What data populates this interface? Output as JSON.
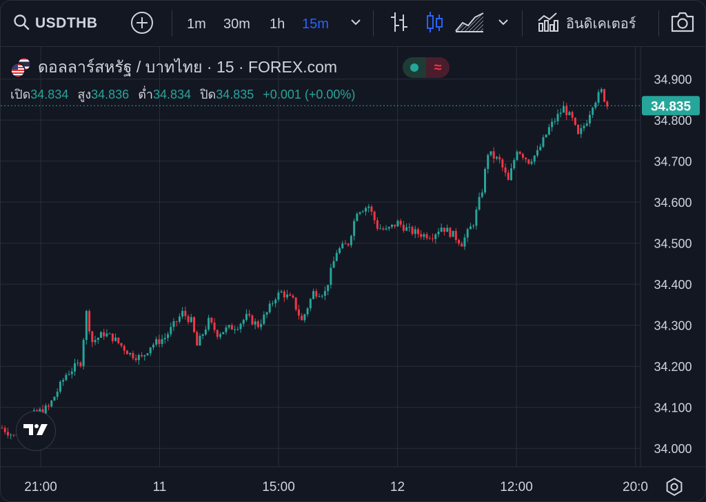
{
  "toolbar": {
    "symbol": "USDTHB",
    "timeframes": [
      {
        "label": "1m",
        "active": false
      },
      {
        "label": "30m",
        "active": false
      },
      {
        "label": "1h",
        "active": false
      },
      {
        "label": "15m",
        "active": true
      }
    ],
    "indicators_label": "อินดิเคเตอร์",
    "icons": [
      "search-icon",
      "plus-circle-icon",
      "chevron-down-icon",
      "bar-chart-icon",
      "candlestick-icon",
      "area-chart-icon",
      "indicators-icon",
      "camera-icon"
    ]
  },
  "legend": {
    "title": "ดอลลาร์สหรัฐ / บาทไทย · 15 · FOREX.com",
    "open_label": "เปิด",
    "open": "34.834",
    "high_label": "สูง",
    "high": "34.836",
    "low_label": "ต่ำ",
    "low": "34.834",
    "close_label": "ปิด",
    "close": "34.835",
    "change": "+0.001 (+0.00%)"
  },
  "colors": {
    "background": "#131722",
    "up": "#26a69a",
    "down": "#f23645",
    "grid": "#2a2e39",
    "accent": "#2962ff"
  },
  "chart_data": {
    "type": "candlestick",
    "symbol": "USDTHB",
    "interval": "15",
    "ylim": [
      33.955,
      34.98
    ],
    "y_ticks": [
      "34.900",
      "34.800",
      "34.700",
      "34.600",
      "34.500",
      "34.400",
      "34.300",
      "34.200",
      "34.100",
      "34.000"
    ],
    "x_ticks": [
      "21:00",
      "11",
      "15:00",
      "12",
      "12:00",
      "20:0"
    ],
    "last_price": "34.835",
    "close_path": [
      [
        0,
        34.05
      ],
      [
        4,
        34.03
      ],
      [
        10,
        34.08
      ],
      [
        16,
        34.1
      ],
      [
        22,
        34.18
      ],
      [
        27,
        34.21
      ],
      [
        29,
        34.33
      ],
      [
        31,
        34.26
      ],
      [
        35,
        34.28
      ],
      [
        38,
        34.27
      ],
      [
        44,
        34.23
      ],
      [
        48,
        34.22
      ],
      [
        51,
        34.25
      ],
      [
        56,
        34.27
      ],
      [
        59,
        34.3
      ],
      [
        62,
        34.33
      ],
      [
        65,
        34.31
      ],
      [
        67,
        34.25
      ],
      [
        71,
        34.31
      ],
      [
        74,
        34.28
      ],
      [
        77,
        34.29
      ],
      [
        81,
        34.3
      ],
      [
        84,
        34.32
      ],
      [
        88,
        34.3
      ],
      [
        91,
        34.33
      ],
      [
        94,
        34.37
      ],
      [
        96,
        34.38
      ],
      [
        100,
        34.36
      ],
      [
        103,
        34.31
      ],
      [
        107,
        34.38
      ],
      [
        111,
        34.38
      ],
      [
        115,
        34.48
      ],
      [
        119,
        34.5
      ],
      [
        122,
        34.58
      ],
      [
        126,
        34.59
      ],
      [
        129,
        34.54
      ],
      [
        132,
        34.53
      ],
      [
        136,
        34.55
      ],
      [
        140,
        34.53
      ],
      [
        145,
        34.52
      ],
      [
        148,
        34.52
      ],
      [
        151,
        34.54
      ],
      [
        155,
        34.52
      ],
      [
        158,
        34.5
      ],
      [
        162,
        34.55
      ],
      [
        165,
        34.63
      ],
      [
        167,
        34.72
      ],
      [
        171,
        34.7
      ],
      [
        174,
        34.65
      ],
      [
        177,
        34.73
      ],
      [
        181,
        34.7
      ],
      [
        184,
        34.72
      ],
      [
        188,
        34.78
      ],
      [
        191,
        34.81
      ],
      [
        193,
        34.83
      ],
      [
        196,
        34.8
      ],
      [
        198,
        34.76
      ],
      [
        201,
        34.8
      ],
      [
        203,
        34.84
      ],
      [
        206,
        34.87
      ],
      [
        208,
        34.835
      ]
    ]
  }
}
